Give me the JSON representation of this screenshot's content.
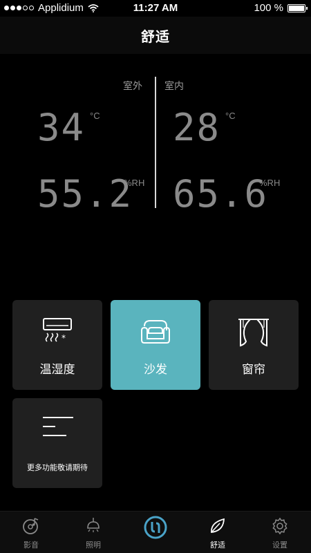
{
  "status_bar": {
    "carrier": "Applidium",
    "time": "11:27 AM",
    "battery": "100 %",
    "signal_bars_filled": 3,
    "signal_bars_total": 5
  },
  "nav": {
    "title": "舒适"
  },
  "climate": {
    "outdoor": {
      "label": "室外",
      "temperature": "34",
      "temp_unit": "°C",
      "humidity": "55.2",
      "humidity_unit": "%RH"
    },
    "indoor": {
      "label": "室内",
      "temperature": "28",
      "temp_unit": "°C",
      "humidity": "65.6",
      "humidity_unit": "%RH"
    }
  },
  "tiles": [
    {
      "label": "温湿度",
      "icon": "air-conditioner-icon",
      "active": false
    },
    {
      "label": "沙发",
      "icon": "sofa-icon",
      "active": true
    },
    {
      "label": "窗帘",
      "icon": "curtain-icon",
      "active": false
    },
    {
      "label": "更多功能敬请期待",
      "icon": "menu-lines-icon",
      "active": false
    }
  ],
  "tabs": [
    {
      "label": "影音",
      "icon": "music-disc-icon",
      "active": false
    },
    {
      "label": "照明",
      "icon": "lamp-icon",
      "active": false
    },
    {
      "label": "",
      "icon": "home-logo-icon",
      "active": false
    },
    {
      "label": "舒适",
      "icon": "leaf-icon",
      "active": true
    },
    {
      "label": "设置",
      "icon": "gear-icon",
      "active": false
    }
  ],
  "colors": {
    "accent": "#5ab4be",
    "tile_bg": "#202020",
    "value_gray": "#8a8a8a"
  }
}
